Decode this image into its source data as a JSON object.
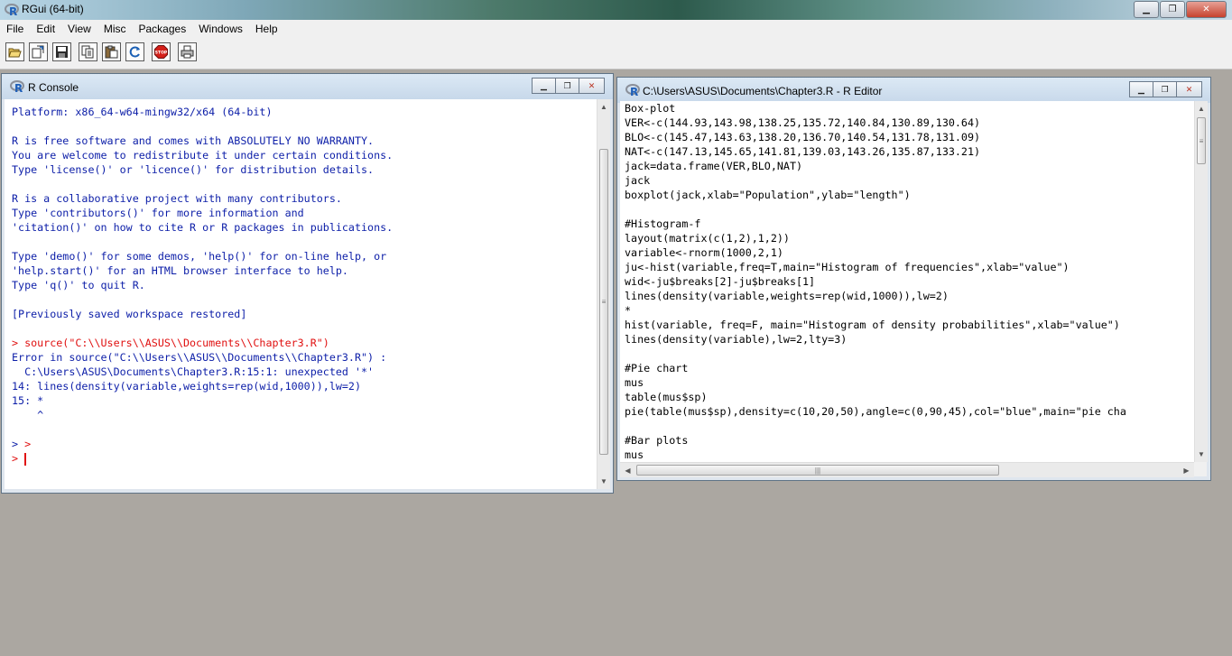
{
  "app": {
    "title": "RGui (64-bit)"
  },
  "menu": [
    "File",
    "Edit",
    "View",
    "Misc",
    "Packages",
    "Windows",
    "Help"
  ],
  "toolbar_icons": [
    "open-script-icon",
    "load-workspace-icon",
    "save-workspace-icon",
    "copy-icon",
    "paste-icon",
    "copy-paste-icon",
    "stop-icon",
    "print-icon"
  ],
  "toolbar": {
    "stop_label": "STOP"
  },
  "console": {
    "title": "R Console",
    "lines": [
      {
        "t": "Platform: x86_64-w64-mingw32/x64 (64-bit)",
        "c": "blue"
      },
      {
        "t": "",
        "c": "blue"
      },
      {
        "t": "R is free software and comes with ABSOLUTELY NO WARRANTY.",
        "c": "blue"
      },
      {
        "t": "You are welcome to redistribute it under certain conditions.",
        "c": "blue"
      },
      {
        "t": "Type 'license()' or 'licence()' for distribution details.",
        "c": "blue"
      },
      {
        "t": "",
        "c": "blue"
      },
      {
        "t": "R is a collaborative project with many contributors.",
        "c": "blue"
      },
      {
        "t": "Type 'contributors()' for more information and",
        "c": "blue"
      },
      {
        "t": "'citation()' on how to cite R or R packages in publications.",
        "c": "blue"
      },
      {
        "t": "",
        "c": "blue"
      },
      {
        "t": "Type 'demo()' for some demos, 'help()' for on-line help, or",
        "c": "blue"
      },
      {
        "t": "'help.start()' for an HTML browser interface to help.",
        "c": "blue"
      },
      {
        "t": "Type 'q()' to quit R.",
        "c": "blue"
      },
      {
        "t": "",
        "c": "blue"
      },
      {
        "t": "[Previously saved workspace restored]",
        "c": "blue"
      },
      {
        "t": "",
        "c": "blue"
      },
      {
        "t": "> source(\"C:\\\\Users\\\\ASUS\\\\Documents\\\\Chapter3.R\")",
        "c": "red"
      },
      {
        "t": "Error in source(\"C:\\\\Users\\\\ASUS\\\\Documents\\\\Chapter3.R\") :",
        "c": "blue"
      },
      {
        "t": "  C:\\Users\\ASUS\\Documents\\Chapter3.R:15:1: unexpected '*'",
        "c": "blue"
      },
      {
        "t": "14: lines(density(variable,weights=rep(wid,1000)),lw=2)",
        "c": "blue"
      },
      {
        "t": "15: *",
        "c": "blue"
      },
      {
        "t": "    ^",
        "c": "blue"
      },
      {
        "t": "",
        "c": "blue"
      }
    ],
    "prompt1_gt": ">",
    "prompt1_red": " >",
    "prompt2": "> "
  },
  "editor": {
    "title": "C:\\Users\\ASUS\\Documents\\Chapter3.R - R Editor",
    "lines": [
      "Box-plot",
      "VER<-c(144.93,143.98,138.25,135.72,140.84,130.89,130.64)",
      "BLO<-c(145.47,143.63,138.20,136.70,140.54,131.78,131.09)",
      "NAT<-c(147.13,145.65,141.81,139.03,143.26,135.87,133.21)",
      "jack=data.frame(VER,BLO,NAT)",
      "jack",
      "boxplot(jack,xlab=\"Population\",ylab=\"length\")",
      "",
      "#Histogram-f",
      "layout(matrix(c(1,2),1,2))",
      "variable<-rnorm(1000,2,1)",
      "ju<-hist(variable,freq=T,main=\"Histogram of frequencies\",xlab=\"value\")",
      "wid<-ju$breaks[2]-ju$breaks[1]",
      "lines(density(variable,weights=rep(wid,1000)),lw=2)",
      "*",
      "hist(variable, freq=F, main=\"Histogram of density probabilities\",xlab=\"value\")",
      "lines(density(variable),lw=2,lty=3)",
      "",
      "#Pie chart",
      "mus",
      "table(mus$sp)",
      "pie(table(mus$sp),density=c(10,20,50),angle=c(0,90,45),col=\"blue\",main=\"pie cha",
      "",
      "#Bar plots",
      "mus"
    ]
  },
  "colors": {
    "console_text": "#0c1ea8",
    "console_input": "#e01010",
    "desktop": "#aba7a1"
  }
}
